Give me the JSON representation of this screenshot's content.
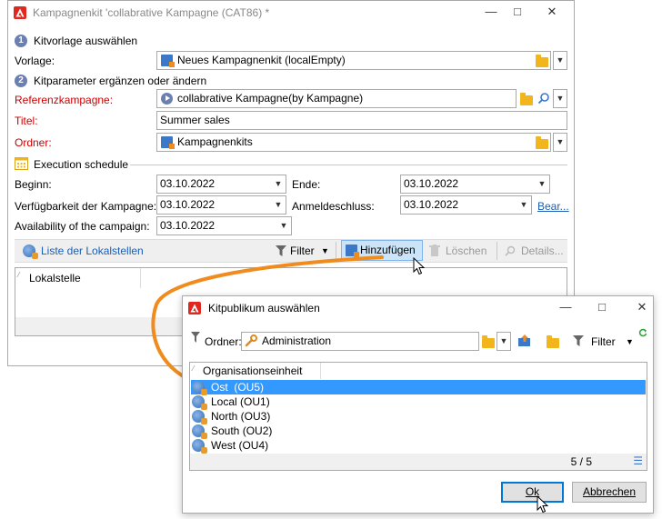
{
  "main_window": {
    "title": "Kampagnenkit 'collabrative Kampagne (CAT86) *",
    "section1": {
      "number": "1",
      "title": "Kitvorlage auswählen"
    },
    "vorlage": {
      "label": "Vorlage:",
      "value": "Neues Kampagnenkit (localEmpty)"
    },
    "section2": {
      "number": "2",
      "title": "Kitparameter ergänzen oder ändern"
    },
    "referenzkampagne": {
      "label": "Referenzkampagne:",
      "value": "collabrative Kampagne(by Kampagne)"
    },
    "titel": {
      "label": "Titel:",
      "value": "Summer sales"
    },
    "ordner": {
      "label": "Ordner:",
      "value": "Kampagnenkits"
    },
    "schedule_title": "Execution schedule",
    "beginn": {
      "label": "Beginn:",
      "value": "03.10.2022"
    },
    "ende": {
      "label": "Ende:",
      "value": "03.10.2022"
    },
    "verfuegbarkeit": {
      "label": "Verfügbarkeit der Kampagne:",
      "value": "03.10.2022"
    },
    "anmeldeschluss": {
      "label": "Anmeldeschluss:",
      "value": "03.10.2022"
    },
    "bear_link": "Bear...",
    "availability": {
      "label": "Availability of the campaign:",
      "value": "03.10.2022"
    },
    "toolbar": {
      "list_label": "Liste der Lokalstellen",
      "filter": "Filter",
      "add": "Hinzufügen",
      "delete": "Löschen",
      "details": "Details..."
    },
    "grid_header": "Lokalstelle"
  },
  "dialog": {
    "title": "Kitpublikum auswählen",
    "ordner_label": "Ordner:",
    "ordner_value": "Administration",
    "filter": "Filter",
    "column_header": "Organisationseinheit",
    "rows": [
      "Ost  (OU5)",
      "Local (OU1)",
      "North (OU3)",
      "South (OU2)",
      "West (OU4)"
    ],
    "selected_index": 0,
    "count": "5 / 5",
    "ok": "Ok",
    "cancel": "Abbrechen"
  },
  "colors": {
    "accent_orange": "#f08c1e",
    "selection": "#3399ff",
    "logo_red": "#e0281f",
    "required_label": "#cc0000",
    "link_blue": "#1a5fb4"
  }
}
